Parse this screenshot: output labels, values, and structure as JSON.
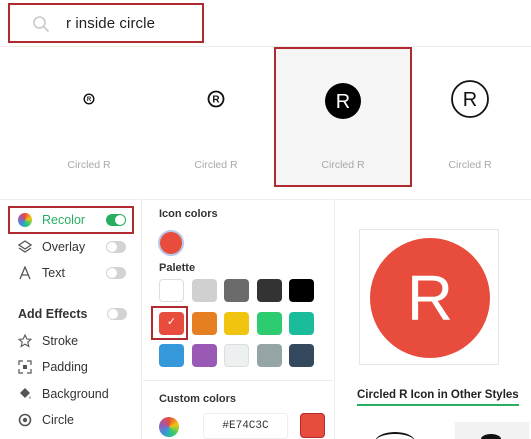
{
  "search": {
    "query": "r inside circle",
    "icon": "search-icon"
  },
  "results": [
    {
      "label": "Circled R",
      "glyph": "R",
      "style": "tiny-outline"
    },
    {
      "label": "Circled R",
      "glyph": "R",
      "style": "small-outline"
    },
    {
      "label": "Circled R",
      "glyph": "R",
      "style": "filled",
      "selected": true
    },
    {
      "label": "Circled R",
      "glyph": "R",
      "style": "large-outline"
    }
  ],
  "options": [
    {
      "label": "Recolor",
      "icon": "palette-wheel-icon",
      "toggle": true
    },
    {
      "label": "Overlay",
      "icon": "overlay-icon",
      "toggle": false
    },
    {
      "label": "Text",
      "icon": "text-icon",
      "toggle": false
    }
  ],
  "effects": {
    "title": "Add Effects",
    "toggle": false,
    "items": [
      {
        "label": "Stroke",
        "icon": "star-outline-icon"
      },
      {
        "label": "Padding",
        "icon": "expand-icon"
      },
      {
        "label": "Background",
        "icon": "paint-bucket-icon"
      },
      {
        "label": "Circle",
        "icon": "circle-icon"
      }
    ]
  },
  "colors": {
    "icon_colors_title": "Icon colors",
    "current": "#E74C3C",
    "palette_title": "Palette",
    "palette": [
      "#FFFFFF",
      "#D0D0D0",
      "#6B6B6B",
      "#333333",
      "#000000",
      "#E74C3C",
      "#E67E22",
      "#F1C40F",
      "#2ECC71",
      "#1ABC9C",
      "#3498DB",
      "#9B59B6",
      "#ECF0F1",
      "#95A5A6",
      "#34495E"
    ],
    "selected_index": 5,
    "custom_title": "Custom colors",
    "hex": "#E74C3C"
  },
  "preview": {
    "glyph": "R",
    "color": "#E74C3C",
    "other_styles_title": "Circled R Icon in Other Styles"
  },
  "accent": "#27AE60",
  "highlight": "#B02A2F"
}
